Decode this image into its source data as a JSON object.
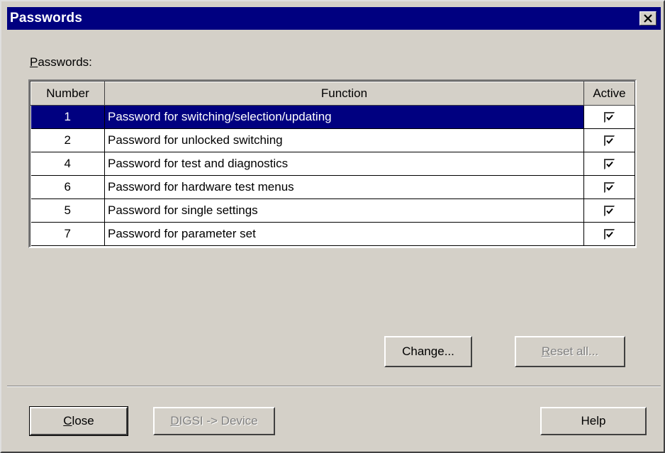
{
  "window": {
    "title": "Passwords"
  },
  "section_label": {
    "first": "P",
    "rest": "asswords:"
  },
  "table": {
    "headers": {
      "number": "Number",
      "function": "Function",
      "active": "Active"
    },
    "rows": [
      {
        "number": "1",
        "function": "Password for switching/selection/updating",
        "active": true,
        "selected": true
      },
      {
        "number": "2",
        "function": "Password for unlocked switching",
        "active": true,
        "selected": false
      },
      {
        "number": "4",
        "function": "Password for test and diagnostics",
        "active": true,
        "selected": false
      },
      {
        "number": "6",
        "function": "Password for hardware test menus",
        "active": true,
        "selected": false
      },
      {
        "number": "5",
        "function": "Password for single settings",
        "active": true,
        "selected": false
      },
      {
        "number": "7",
        "function": "Password for parameter set",
        "active": true,
        "selected": false
      }
    ]
  },
  "buttons": {
    "change": {
      "pre": "Chan",
      "u": "g",
      "post": "e..."
    },
    "reset_all": {
      "pre": "",
      "u": "R",
      "post": "eset all..."
    },
    "close": {
      "pre": "",
      "u": "C",
      "post": "lose"
    },
    "digsi_device": {
      "pre": "",
      "u": "D",
      "post": "IGSI -> Device"
    },
    "help": {
      "pre": "",
      "u": "",
      "post": "Help"
    }
  },
  "colors": {
    "titlebar": "#000080",
    "dialog_bg": "#d4d0c8",
    "selection": "#000080"
  },
  "icons": {
    "close": "close-x-icon",
    "checkbox": "checkmark-icon"
  }
}
